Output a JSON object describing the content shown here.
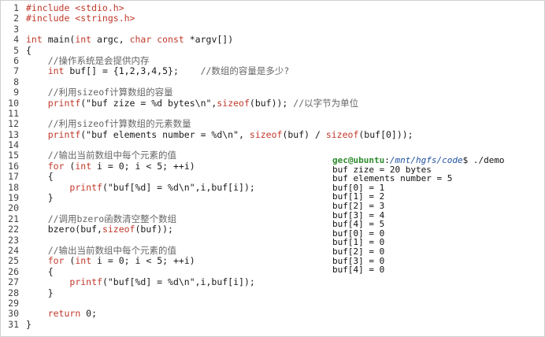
{
  "code_lines": [
    {
      "n": "1",
      "segs": [
        {
          "t": "#include <stdio.h>",
          "c": "pp"
        }
      ]
    },
    {
      "n": "2",
      "segs": [
        {
          "t": "#include <strings.h>",
          "c": "pp"
        }
      ]
    },
    {
      "n": "3",
      "segs": []
    },
    {
      "n": "4",
      "segs": [
        {
          "t": "int",
          "c": "kw"
        },
        {
          "t": " main(",
          "c": "code"
        },
        {
          "t": "int",
          "c": "kw"
        },
        {
          "t": " argc, ",
          "c": "code"
        },
        {
          "t": "char const",
          "c": "kw"
        },
        {
          "t": " *argv[])",
          "c": "code"
        }
      ]
    },
    {
      "n": "5",
      "segs": [
        {
          "t": "{",
          "c": "code"
        }
      ]
    },
    {
      "n": "6",
      "segs": [
        {
          "t": "    //操作系统是会提供内存",
          "c": "cm"
        }
      ]
    },
    {
      "n": "7",
      "segs": [
        {
          "t": "    ",
          "c": "code"
        },
        {
          "t": "int",
          "c": "kw"
        },
        {
          "t": " buf[] = {1,2,3,4,5};    ",
          "c": "code"
        },
        {
          "t": "//数组的容量是多少?",
          "c": "cm"
        }
      ]
    },
    {
      "n": "8",
      "segs": []
    },
    {
      "n": "9",
      "segs": [
        {
          "t": "    //利用sizeof计算数组的容量",
          "c": "cm"
        }
      ]
    },
    {
      "n": "10",
      "segs": [
        {
          "t": "    ",
          "c": "code"
        },
        {
          "t": "printf",
          "c": "fn"
        },
        {
          "t": "(\"buf zize = %d bytes\\n\",",
          "c": "code"
        },
        {
          "t": "sizeof",
          "c": "kw"
        },
        {
          "t": "(buf)); ",
          "c": "code"
        },
        {
          "t": "//以字节为单位",
          "c": "cm"
        }
      ]
    },
    {
      "n": "11",
      "segs": []
    },
    {
      "n": "12",
      "segs": [
        {
          "t": "    //利用sizeof计算数组的元素数量",
          "c": "cm"
        }
      ]
    },
    {
      "n": "13",
      "segs": [
        {
          "t": "    ",
          "c": "code"
        },
        {
          "t": "printf",
          "c": "fn"
        },
        {
          "t": "(\"buf elements number = %d\\n\", ",
          "c": "code"
        },
        {
          "t": "sizeof",
          "c": "kw"
        },
        {
          "t": "(buf) / ",
          "c": "code"
        },
        {
          "t": "sizeof",
          "c": "kw"
        },
        {
          "t": "(buf[0]));",
          "c": "code"
        }
      ]
    },
    {
      "n": "14",
      "segs": []
    },
    {
      "n": "15",
      "segs": [
        {
          "t": "    //输出当前数组中每个元素的值",
          "c": "cm"
        }
      ]
    },
    {
      "n": "16",
      "segs": [
        {
          "t": "    ",
          "c": "code"
        },
        {
          "t": "for",
          "c": "kw"
        },
        {
          "t": " (",
          "c": "code"
        },
        {
          "t": "int",
          "c": "kw"
        },
        {
          "t": " i = 0; i < 5; ++i)",
          "c": "code"
        }
      ]
    },
    {
      "n": "17",
      "segs": [
        {
          "t": "    {",
          "c": "code"
        }
      ]
    },
    {
      "n": "18",
      "segs": [
        {
          "t": "        ",
          "c": "code"
        },
        {
          "t": "printf",
          "c": "fn"
        },
        {
          "t": "(\"buf[%d] = %d\\n\",i,buf[i]);",
          "c": "code"
        }
      ]
    },
    {
      "n": "19",
      "segs": [
        {
          "t": "    }",
          "c": "code"
        }
      ]
    },
    {
      "n": "20",
      "segs": []
    },
    {
      "n": "21",
      "segs": [
        {
          "t": "    //调用bzero函数清空整个数组",
          "c": "cm"
        }
      ]
    },
    {
      "n": "22",
      "segs": [
        {
          "t": "    bzero(buf,",
          "c": "code"
        },
        {
          "t": "sizeof",
          "c": "kw"
        },
        {
          "t": "(buf));",
          "c": "code"
        }
      ]
    },
    {
      "n": "23",
      "segs": []
    },
    {
      "n": "24",
      "segs": [
        {
          "t": "    //输出当前数组中每个元素的值",
          "c": "cm"
        }
      ]
    },
    {
      "n": "25",
      "segs": [
        {
          "t": "    ",
          "c": "code"
        },
        {
          "t": "for",
          "c": "kw"
        },
        {
          "t": " (",
          "c": "code"
        },
        {
          "t": "int",
          "c": "kw"
        },
        {
          "t": " i = 0; i < 5; ++i)",
          "c": "code"
        }
      ]
    },
    {
      "n": "26",
      "segs": [
        {
          "t": "    {",
          "c": "code"
        }
      ]
    },
    {
      "n": "27",
      "segs": [
        {
          "t": "        ",
          "c": "code"
        },
        {
          "t": "printf",
          "c": "fn"
        },
        {
          "t": "(\"buf[%d] = %d\\n\",i,buf[i]);",
          "c": "code"
        }
      ]
    },
    {
      "n": "28",
      "segs": [
        {
          "t": "    }",
          "c": "code"
        }
      ]
    },
    {
      "n": "29",
      "segs": []
    },
    {
      "n": "30",
      "segs": [
        {
          "t": "    ",
          "c": "code"
        },
        {
          "t": "return",
          "c": "kw"
        },
        {
          "t": " 0;",
          "c": "code"
        }
      ]
    },
    {
      "n": "31",
      "segs": [
        {
          "t": "}",
          "c": "code"
        }
      ]
    }
  ],
  "terminal": {
    "prompt_user": "gec@ubuntu",
    "prompt_sep": ":",
    "prompt_path": "/mnt/hgfs/code",
    "prompt_tail": "$ ./demo",
    "output": [
      "buf zize = 20 bytes",
      "buf elements number = 5",
      "buf[0] = 1",
      "buf[1] = 2",
      "buf[2] = 3",
      "buf[3] = 4",
      "buf[4] = 5",
      "buf[0] = 0",
      "buf[1] = 0",
      "buf[2] = 0",
      "buf[3] = 0",
      "buf[4] = 0"
    ]
  },
  "colors": {
    "keyword": "#c0392b",
    "comment": "#666666",
    "prompt_user": "#2e8b2e",
    "prompt_path": "#1e50a0"
  }
}
